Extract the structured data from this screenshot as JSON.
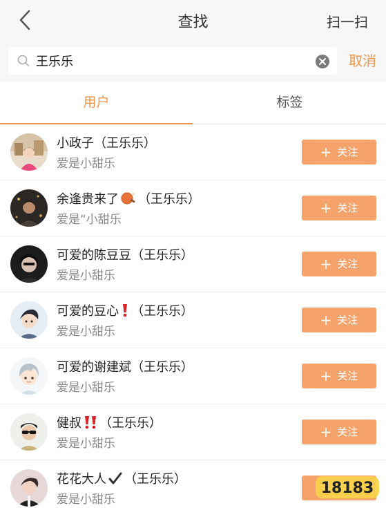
{
  "header": {
    "title": "查找",
    "scan_label": "扫一扫"
  },
  "search": {
    "value": "王乐乐",
    "cancel_label": "取消"
  },
  "tabs": [
    {
      "label": "用户",
      "active": true
    },
    {
      "label": "标签",
      "active": false
    }
  ],
  "follow_label": "关注",
  "accent_color": "#f0944b",
  "button_color": "#f5a36a",
  "users": [
    {
      "name": "小政子（王乐乐）",
      "bio": "爱是小甜乐"
    },
    {
      "name_prefix": "余逢贵来了",
      "name_emoji": "ping-pong-icon",
      "name_suffix": "（王乐乐）",
      "bio": "爱是“小甜乐"
    },
    {
      "name": "可爱的陈豆豆（王乐乐）",
      "bio": "爱是小甜乐"
    },
    {
      "name_prefix": "可爱的豆心",
      "name_emoji": "red-exclamation-icon",
      "name_suffix": "（王乐乐）",
      "bio": "爱是小甜乐"
    },
    {
      "name": "可爱的谢建斌（王乐乐）",
      "bio": "爱是小甜乐"
    },
    {
      "name_prefix": "健叔",
      "name_emoji": "double-exclamation-icon",
      "name_suffix": "（王乐乐）",
      "bio": "爱是小甜乐"
    },
    {
      "name_prefix": "花花大人",
      "name_emoji": "checkmark-icon",
      "name_suffix": "（王乐乐）",
      "bio": "爱是小甜乐"
    }
  ],
  "watermark": "18183"
}
